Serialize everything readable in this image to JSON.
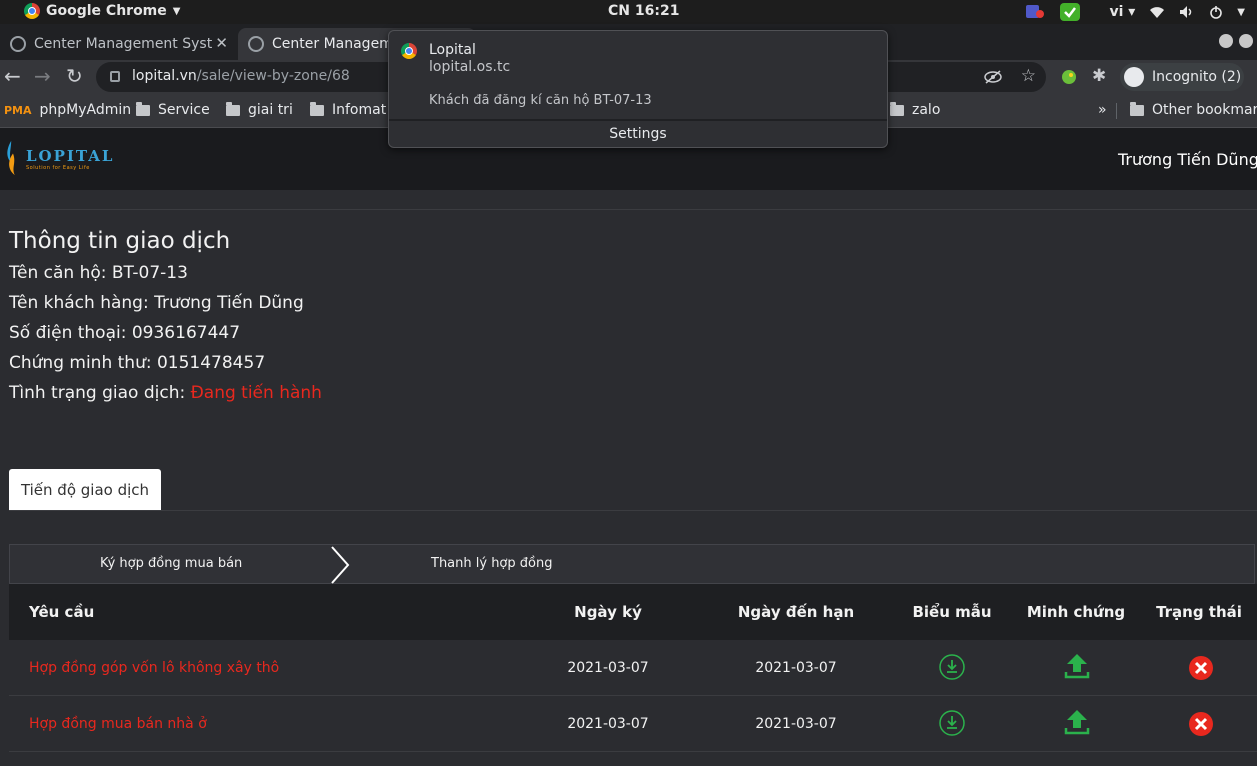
{
  "os_bar": {
    "app_name": "Google Chrome",
    "clock": "CN 16:21",
    "lang": "vi"
  },
  "browser": {
    "tabs": [
      {
        "title": "Center Management Syst"
      },
      {
        "title": "Center Managem"
      }
    ],
    "url_host": "lopital.vn",
    "url_path": "/sale/view-by-zone/68",
    "incognito_label": "Incognito (2)",
    "bookmarks": [
      {
        "label": "phpMyAdmin"
      },
      {
        "label": "Service"
      },
      {
        "label": "giai tri"
      },
      {
        "label": "Infomat"
      },
      {
        "label": "zalo"
      },
      {
        "label": "Other bookmar"
      }
    ],
    "more_bookmarks": "»"
  },
  "notification": {
    "title": "Lopital",
    "origin": "lopital.os.tc",
    "body": "Khách đã đăng kí căn hộ  BT-07-13",
    "settings": "Settings"
  },
  "app": {
    "logo_name": "LOPITAL",
    "logo_tagline": "Solution for Easy Life",
    "user_name": "Trương Tiến  Dũng"
  },
  "info": {
    "title": "Thông tin giao dịch",
    "apartment": "Tên căn hộ:  BT-07-13",
    "customer": "Tên khách hàng: Trương Tiến  Dũng",
    "phone": "Số điện thoại: 0936167447",
    "id_card": "Chứng minh thư: 0151478457",
    "status_label": "Tình trạng giao dịch: ",
    "status_value": "Đang tiến hành",
    "status_color": "#e8281e"
  },
  "tabs": {
    "progress": "Tiến độ giao dịch"
  },
  "steps": [
    "Ký hợp đồng mua bán",
    "Thanh lý hợp đồng"
  ],
  "table": {
    "headers": {
      "request": "Yêu cầu",
      "sign_date": "Ngày ký",
      "due_date": "Ngày đến hạn",
      "template": "Biểu mẫu",
      "evidence": "Minh chứng",
      "status": "Trạng thái"
    },
    "rows": [
      {
        "request": "Hợp đồng góp vốn lô không xây thô",
        "sign_date": "2021-03-07",
        "due_date": "2021-03-07",
        "template_icon": "download-icon",
        "evidence_icon": "upload-icon",
        "status_icon": "rejected-icon"
      },
      {
        "request": "Hợp đồng mua bán nhà ở",
        "sign_date": "2021-03-07",
        "due_date": "2021-03-07",
        "template_icon": "download-icon",
        "evidence_icon": "upload-icon",
        "status_icon": "rejected-icon"
      }
    ]
  },
  "colors": {
    "accent_red": "#e8281e",
    "icon_green": "#2bb24c",
    "status_red": "#e8281e"
  }
}
